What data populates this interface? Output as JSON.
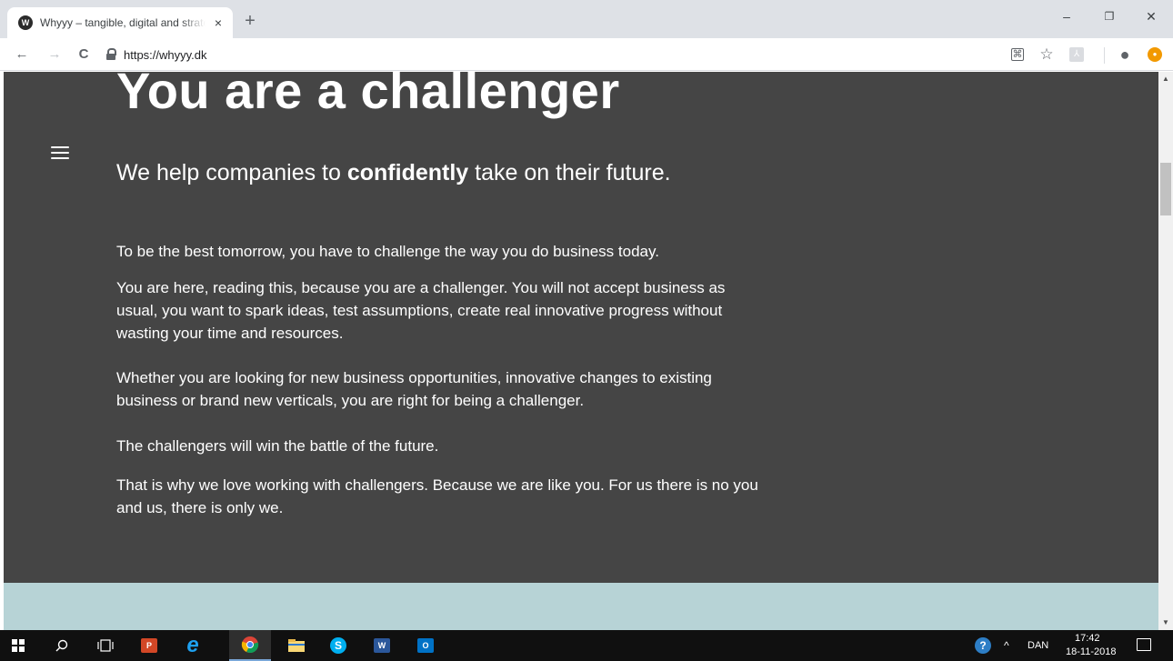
{
  "browser": {
    "tab": {
      "favicon_letter": "W",
      "title": "Whyyy – tangible, digital and strategic",
      "close": "×"
    },
    "new_tab": "+",
    "window_controls": {
      "minimize": "–",
      "maximize": "❐",
      "close": "✕"
    },
    "nav": {
      "back": "←",
      "forward": "→",
      "reload": "C"
    },
    "url": "https://whyyy.dk",
    "toolbar_icons": {
      "translate": "⌘",
      "bookmark": "☆",
      "pdf": "⅄",
      "profile": "●",
      "extension": "●"
    }
  },
  "page": {
    "headline": "You are a challenger",
    "subline_before": "We help companies to ",
    "subline_bold": "confidently",
    "subline_after": " take on their future.",
    "paragraphs": [
      "To be the best tomorrow, you have to challenge the way you do business today.",
      "You are here, reading this, because you are a challenger. You will not accept business as usual, you want to spark ideas, test assumptions, create real innovative progress without wasting your time and resources.",
      "Whether you are looking for new business opportunities, innovative changes to existing business or brand new verticals, you are right for being a challenger.",
      "The challengers will win the battle of the future.",
      "That is why we love working with challengers. Because we are like you. For us there is no you and us, there is only we."
    ],
    "colors": {
      "dark_section": "#454545",
      "teal_section": "#b7d3d6"
    }
  },
  "taskbar": {
    "apps": [
      "windows-start",
      "search",
      "task-view",
      "powerpoint",
      "internet-explorer",
      "chrome",
      "file-explorer",
      "skype",
      "word",
      "outlook"
    ],
    "powerpoint_label": "P",
    "word_label": "W",
    "outlook_label": "O",
    "skype_label": "S",
    "ie_label": "e",
    "tray_chevron": "^",
    "language": "DAN",
    "time": "17:42",
    "date": "18-11-2018"
  }
}
